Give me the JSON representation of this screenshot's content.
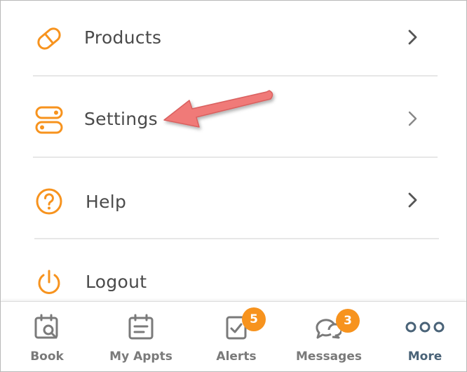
{
  "menu": {
    "items": [
      {
        "label": "Products",
        "icon": "products-pill-icon"
      },
      {
        "label": "Settings",
        "icon": "settings-toggle-icon"
      },
      {
        "label": "Help",
        "icon": "help-question-icon"
      },
      {
        "label": "Logout",
        "icon": "power-icon"
      }
    ]
  },
  "tabbar": {
    "tabs": [
      {
        "label": "Book",
        "icon": "calendar-search-icon"
      },
      {
        "label": "My Appts",
        "icon": "calendar-list-icon"
      },
      {
        "label": "Alerts",
        "icon": "checklist-icon",
        "badge": "5"
      },
      {
        "label": "Messages",
        "icon": "chat-bubbles-icon",
        "badge": "3"
      },
      {
        "label": "More",
        "icon": "more-dots-icon",
        "active": true
      }
    ]
  },
  "colors": {
    "accent": "#f7931e",
    "text": "#4a4a4a",
    "tab_inactive": "#7a7a7a",
    "tab_active": "#4a6378",
    "annotation_arrow": "#f07a78"
  }
}
